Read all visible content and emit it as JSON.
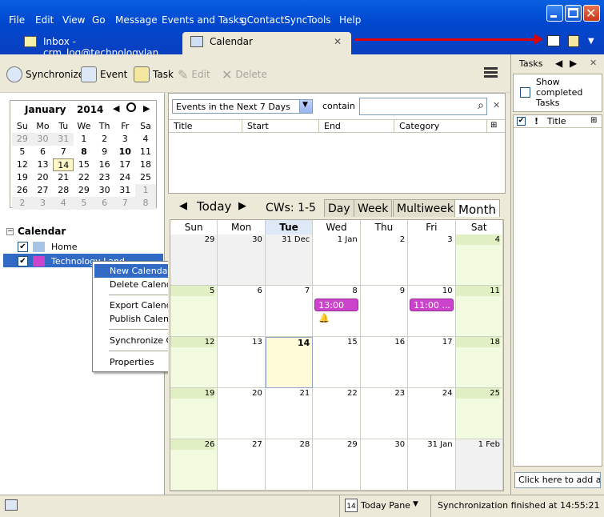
{
  "menu": [
    "File",
    "Edit",
    "View",
    "Go",
    "Message",
    "Events and Tasks",
    "gContactSync",
    "Tools",
    "Help"
  ],
  "tabs": {
    "inbox": "Inbox - crm_log@technologylan...",
    "calendar": "Calendar"
  },
  "toolbar": {
    "synchronize": "Synchronize",
    "event": "Event",
    "task": "Task",
    "edit": "Edit",
    "delete": "Delete"
  },
  "minical": {
    "month": "January",
    "year": "2014",
    "weekdays": [
      "Su",
      "Mo",
      "Tu",
      "We",
      "Th",
      "Fr",
      "Sa"
    ],
    "weeks": [
      [
        "29",
        "30",
        "31",
        "1",
        "2",
        "3",
        "4"
      ],
      [
        "5",
        "6",
        "7",
        "8",
        "9",
        "10",
        "11"
      ],
      [
        "12",
        "13",
        "14",
        "15",
        "16",
        "17",
        "18"
      ],
      [
        "19",
        "20",
        "21",
        "22",
        "23",
        "24",
        "25"
      ],
      [
        "26",
        "27",
        "28",
        "29",
        "30",
        "31",
        "1"
      ],
      [
        "2",
        "3",
        "4",
        "5",
        "6",
        "7",
        "8"
      ]
    ]
  },
  "calendars": {
    "header": "Calendar",
    "items": [
      {
        "name": "Home",
        "color": "#a8c4e4"
      },
      {
        "name": "Technology Land",
        "color": "#cc44cc"
      }
    ]
  },
  "context_menu": [
    "New Calendar...",
    "Delete Calendar",
    "Export Calendar...",
    "Publish Calendar...",
    "Synchronize Calendars",
    "Properties"
  ],
  "events_filter": {
    "selected": "Events in the Next 7 Days",
    "contain_label": "contain",
    "columns": [
      "Title",
      "Start",
      "End",
      "Category"
    ]
  },
  "calview": {
    "today": "Today",
    "cws": "CWs: 1-5",
    "views": [
      "Day",
      "Week",
      "Multiweek",
      "Month"
    ],
    "days": [
      "Sun",
      "Mon",
      "Tue",
      "Wed",
      "Thu",
      "Fri",
      "Sat"
    ],
    "weeks": [
      [
        "29",
        "30",
        "31 Dec",
        "1 Jan",
        "2",
        "3",
        "4"
      ],
      [
        "5",
        "6",
        "7",
        "8",
        "9",
        "10",
        "11"
      ],
      [
        "12",
        "13",
        "14",
        "15",
        "16",
        "17",
        "18"
      ],
      [
        "19",
        "20",
        "21",
        "22",
        "23",
        "24",
        "25"
      ],
      [
        "26",
        "27",
        "28",
        "29",
        "30",
        "31 Jan",
        "1 Feb"
      ]
    ],
    "events": [
      {
        "label": "13:00 🔔"
      },
      {
        "label": "11:00 ..."
      }
    ]
  },
  "tasks": {
    "title": "Tasks",
    "show_completed": "Show completed Tasks",
    "col_title": "Title",
    "add_placeholder": "Click here to add a r"
  },
  "status": {
    "today_pane": "Today Pane",
    "today_num": "14",
    "sync": "Synchronization finished at 14:55:21"
  }
}
